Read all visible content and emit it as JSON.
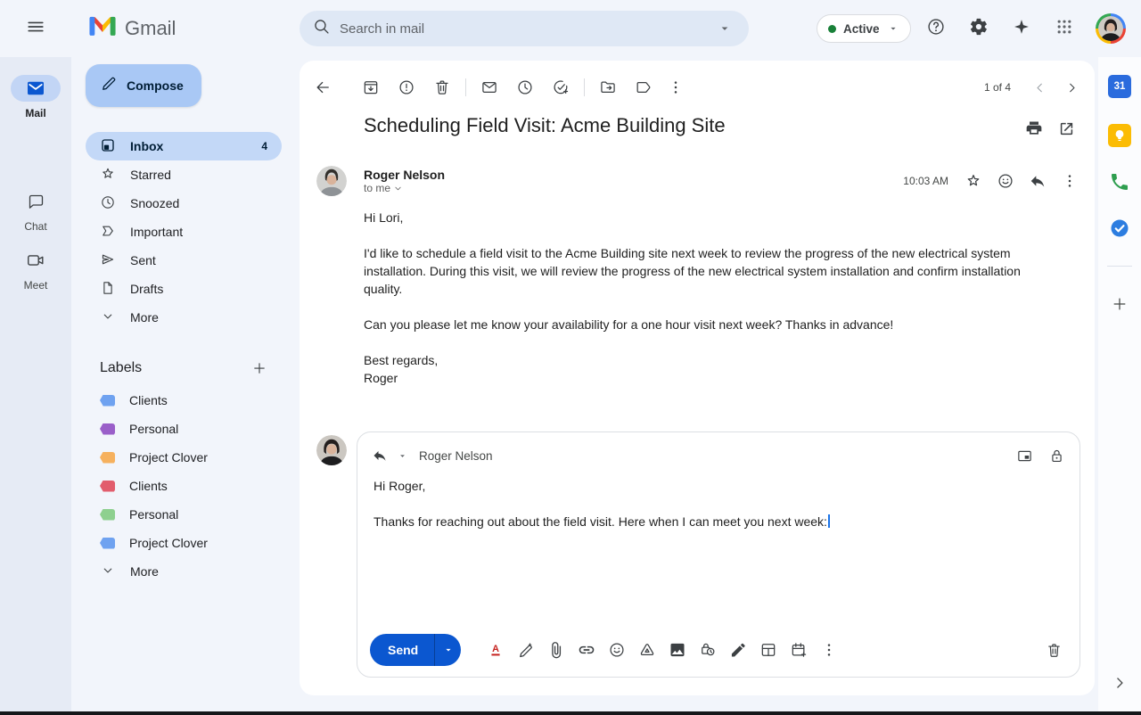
{
  "header": {
    "logo_text": "Gmail",
    "search_placeholder": "Search in mail",
    "status": {
      "label": "Active"
    }
  },
  "rail": {
    "items": [
      {
        "label": "Mail"
      },
      {
        "label": "Chat"
      },
      {
        "label": "Meet"
      }
    ]
  },
  "sidebar": {
    "compose_label": "Compose",
    "items": [
      {
        "label": "Inbox",
        "count": "4"
      },
      {
        "label": "Starred"
      },
      {
        "label": "Snoozed"
      },
      {
        "label": "Important"
      },
      {
        "label": "Sent"
      },
      {
        "label": "Drafts"
      },
      {
        "label": "More"
      }
    ],
    "labels_header": "Labels",
    "labels": [
      {
        "name": "Clients",
        "color": "#6fa2f0"
      },
      {
        "name": "Personal",
        "color": "#9a5fc9"
      },
      {
        "name": "Project Clover",
        "color": "#f6b15e"
      },
      {
        "name": "Clients",
        "color": "#e25d6d"
      },
      {
        "name": "Personal",
        "color": "#8ed08f"
      },
      {
        "name": "Project Clover",
        "color": "#6fa2f0"
      }
    ],
    "labels_more": "More"
  },
  "thread": {
    "pagination": "1 of 4",
    "subject": "Scheduling Field Visit: Acme Building Site",
    "message": {
      "sender": "Roger Nelson",
      "recipient": "to me",
      "time": "10:03 AM",
      "body": [
        "Hi Lori,",
        "I'd like to schedule a field visit to the Acme Building site next week to review the progress of the new electrical system installation. During this visit, we will review the progress of the new electrical system installation and confirm installation quality.",
        "Can you please let me know your availability for a one hour visit next week? Thanks in advance!",
        "Best regards,",
        "Roger"
      ]
    }
  },
  "reply": {
    "recipient": "Roger Nelson",
    "body": [
      "Hi Roger,",
      "Thanks for reaching out about the field visit. Here when I can meet you next week:"
    ],
    "send_label": "Send"
  }
}
